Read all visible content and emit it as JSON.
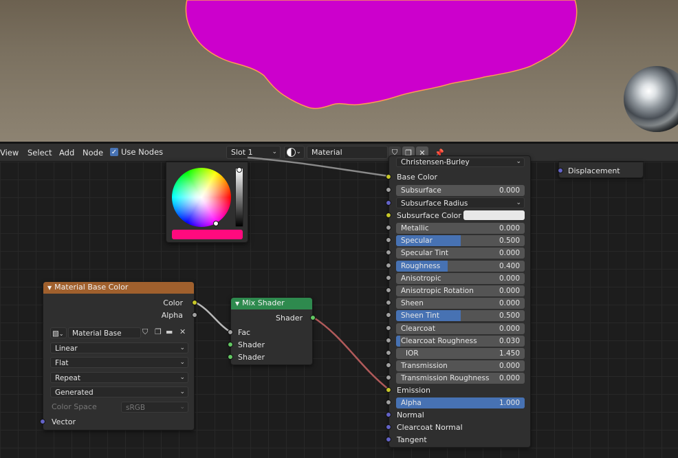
{
  "header": {
    "menu": [
      "View",
      "Select",
      "Add",
      "Node"
    ],
    "use_nodes_label": "Use Nodes",
    "use_nodes_checked": true,
    "slot_label": "Slot 1",
    "material_name": "Material"
  },
  "color_picker": {
    "current_color": "#ff0a7e"
  },
  "image_node": {
    "title": "Material Base Color",
    "header_color": "#a0602d",
    "outputs": [
      "Color",
      "Alpha"
    ],
    "image_name": "Material Base Color",
    "interpolation": "Linear",
    "projection": "Flat",
    "extension": "Repeat",
    "source": "Generated",
    "color_space_label": "Color Space",
    "color_space_value": "sRGB",
    "input_vector": "Vector"
  },
  "mix_node": {
    "title": "Mix Shader",
    "header_color": "#2e8a4e",
    "output": "Shader",
    "inputs": [
      "Fac",
      "Shader",
      "Shader"
    ]
  },
  "bsdf_node": {
    "subsurface_method": "Christensen-Burley",
    "base_color_label": "Base Color",
    "subsurface": {
      "label": "Subsurface",
      "value": "0.000"
    },
    "subsurface_radius": "Subsurface Radius",
    "subsurface_color": "Subsurface Color",
    "fields": [
      {
        "label": "Metallic",
        "value": "0.000",
        "fill": 0.0
      },
      {
        "label": "Specular",
        "value": "0.500",
        "fill": 0.5
      },
      {
        "label": "Specular Tint",
        "value": "0.000",
        "fill": 0.0
      },
      {
        "label": "Roughness",
        "value": "0.400",
        "fill": 0.4
      },
      {
        "label": "Anisotropic",
        "value": "0.000",
        "fill": 0.0
      },
      {
        "label": "Anisotropic Rotation",
        "value": "0.000",
        "fill": 0.0
      },
      {
        "label": "Sheen",
        "value": "0.000",
        "fill": 0.0
      },
      {
        "label": "Sheen Tint",
        "value": "0.500",
        "fill": 0.5
      },
      {
        "label": "Clearcoat",
        "value": "0.000",
        "fill": 0.0
      },
      {
        "label": "Clearcoat Roughness",
        "value": "0.030",
        "fill": 0.03
      },
      {
        "label": "IOR",
        "value": "1.450",
        "fill": 0.0
      },
      {
        "label": "Transmission",
        "value": "0.000",
        "fill": 0.0
      },
      {
        "label": "Transmission Roughness",
        "value": "0.000",
        "fill": 0.0
      }
    ],
    "emission_label": "Emission",
    "alpha": {
      "label": "Alpha",
      "value": "1.000",
      "fill": 1.0
    },
    "bottom_inputs": [
      "Normal",
      "Clearcoat Normal",
      "Tangent"
    ]
  },
  "output_node": {
    "displacement_label": "Displacement"
  }
}
